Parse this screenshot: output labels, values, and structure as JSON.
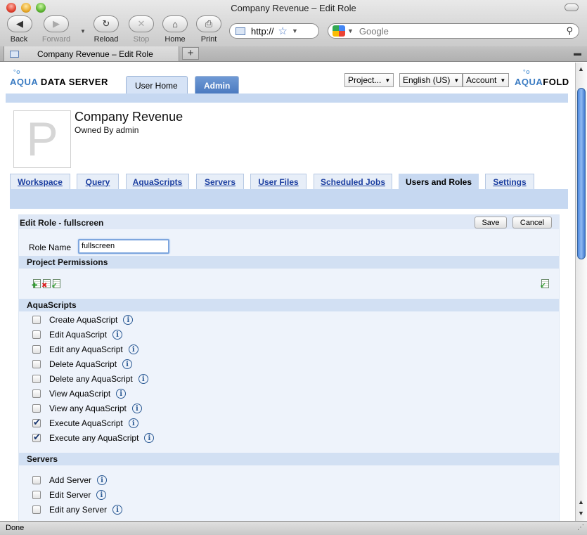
{
  "window": {
    "title": "Company Revenue – Edit Role"
  },
  "nav": {
    "back": "Back",
    "forward": "Forward",
    "reload": "Reload",
    "stop": "Stop",
    "home": "Home",
    "print": "Print",
    "url": "http://",
    "search_placeholder": "Google"
  },
  "browser_tab": {
    "label": "Company Revenue – Edit Role",
    "new_tab": "+"
  },
  "header": {
    "logo_left_aqua": "AQUA",
    "logo_left_rest": " DATA SERVER",
    "logo_right_aqua": "AQUA",
    "logo_right_rest": "FOLD",
    "tab_user_home": "User Home",
    "tab_admin": "Admin",
    "project_select": "Project...",
    "language_select": "English (US)",
    "account_select": "Account"
  },
  "project": {
    "initial": "P",
    "title": "Company Revenue",
    "owner": "Owned By admin"
  },
  "tabs": [
    "Workspace",
    "Query",
    "AquaScripts",
    "Servers",
    "User Files",
    "Scheduled Jobs",
    "Users and Roles",
    "Settings"
  ],
  "active_tab": "Users and Roles",
  "edit_role": {
    "title": "Edit Role - fullscreen",
    "save": "Save",
    "cancel": "Cancel",
    "role_name_label": "Role Name",
    "role_name_value": "fullscreen"
  },
  "sections": {
    "project_permissions": "Project Permissions",
    "aquascripts": "AquaScripts",
    "servers": "Servers"
  },
  "aquascripts": [
    {
      "label": "Create AquaScript",
      "checked": false
    },
    {
      "label": "Edit AquaScript",
      "checked": false
    },
    {
      "label": "Edit any AquaScript",
      "checked": false
    },
    {
      "label": "Delete AquaScript",
      "checked": false
    },
    {
      "label": "Delete any AquaScript",
      "checked": false
    },
    {
      "label": "View AquaScript",
      "checked": false
    },
    {
      "label": "View any AquaScript",
      "checked": false
    },
    {
      "label": "Execute AquaScript",
      "checked": true
    },
    {
      "label": "Execute any AquaScript",
      "checked": true
    }
  ],
  "servers": [
    {
      "label": "Add Server",
      "checked": false
    },
    {
      "label": "Edit Server",
      "checked": false
    },
    {
      "label": "Edit any Server",
      "checked": false
    }
  ],
  "info_glyph": "i",
  "status": {
    "text": "Done"
  },
  "icons": {
    "back": "arrow-left-icon",
    "forward": "arrow-right-icon",
    "reload": "reload-icon",
    "stop": "stop-icon",
    "home": "home-icon",
    "print": "print-icon",
    "bookmark": "star-icon",
    "search": "magnifier-icon"
  },
  "colors": {
    "accent": "#3a7bc2",
    "tab_band": "#c6d8f1",
    "link": "#1b3ea0",
    "admin_tab": "#4b7ac0"
  }
}
